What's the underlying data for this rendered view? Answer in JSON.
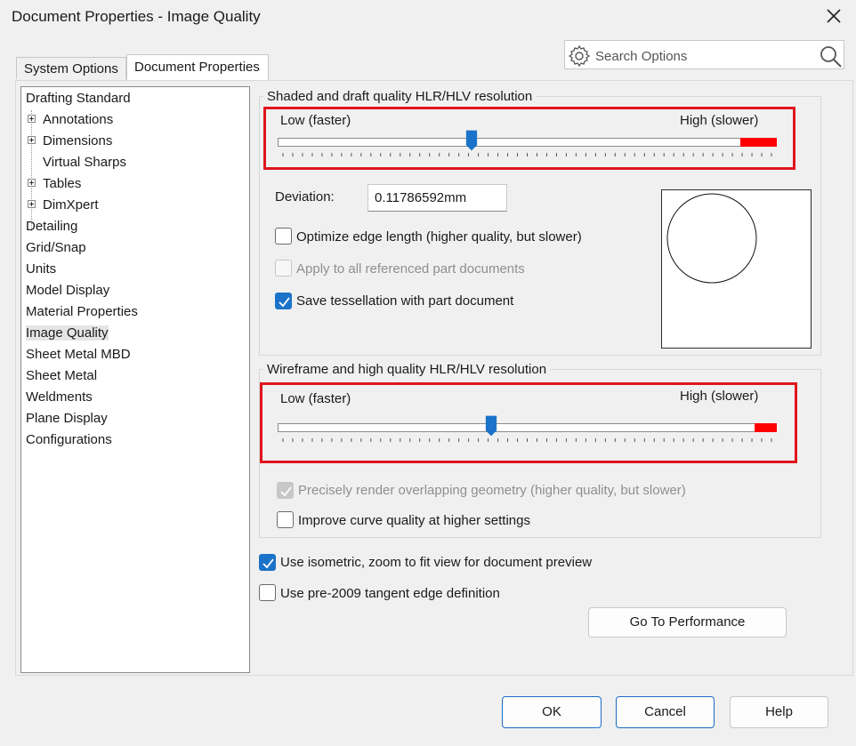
{
  "window": {
    "title": "Document Properties - Image Quality"
  },
  "search": {
    "placeholder": "Search Options"
  },
  "tabs": [
    {
      "label": "System Options",
      "selected": false
    },
    {
      "label": "Document Properties",
      "selected": true
    }
  ],
  "tree": [
    {
      "label": "Drafting Standard",
      "expandable": false,
      "indent": 0
    },
    {
      "label": "Annotations",
      "expandable": true,
      "indent": 1
    },
    {
      "label": "Dimensions",
      "expandable": true,
      "indent": 1
    },
    {
      "label": "Virtual Sharps",
      "expandable": false,
      "indent": 1
    },
    {
      "label": "Tables",
      "expandable": true,
      "indent": 1
    },
    {
      "label": "DimXpert",
      "expandable": true,
      "indent": 1
    },
    {
      "label": "Detailing",
      "expandable": false,
      "indent": 0
    },
    {
      "label": "Grid/Snap",
      "expandable": false,
      "indent": 0
    },
    {
      "label": "Units",
      "expandable": false,
      "indent": 0
    },
    {
      "label": "Model Display",
      "expandable": false,
      "indent": 0
    },
    {
      "label": "Material Properties",
      "expandable": false,
      "indent": 0
    },
    {
      "label": "Image Quality",
      "expandable": false,
      "indent": 0,
      "selected": true
    },
    {
      "label": "Sheet Metal MBD",
      "expandable": false,
      "indent": 0
    },
    {
      "label": "Sheet Metal",
      "expandable": false,
      "indent": 0
    },
    {
      "label": "Weldments",
      "expandable": false,
      "indent": 0
    },
    {
      "label": "Plane Display",
      "expandable": false,
      "indent": 0
    },
    {
      "label": "Configurations",
      "expandable": false,
      "indent": 0
    }
  ],
  "shaded": {
    "group_label": "Shaded and draft quality HLR/HLV resolution",
    "low_label": "Low (faster)",
    "high_label": "High (slower)",
    "slider_fraction": 0.39,
    "deviation_label": "Deviation:",
    "deviation_value": "0.11786592mm",
    "optimize_label": "Optimize edge length (higher quality, but slower)",
    "optimize_checked": false,
    "apply_label": "Apply to all referenced part documents",
    "apply_checked": false,
    "apply_enabled": false,
    "save_tess_label": "Save tessellation with part document",
    "save_tess_checked": true
  },
  "wireframe": {
    "group_label": "Wireframe and high quality HLR/HLV resolution",
    "low_label": "Low (faster)",
    "high_label": "High (slower)",
    "slider_fraction": 0.43,
    "precise_label": "Precisely render overlapping geometry (higher quality, but slower)",
    "precise_checked": true,
    "precise_enabled": false,
    "curve_label": "Improve curve quality at higher settings",
    "curve_checked": false
  },
  "options": {
    "isometric_label": "Use isometric, zoom to fit view for document preview",
    "isometric_checked": true,
    "pre2009_label": "Use pre-2009 tangent edge definition",
    "pre2009_checked": false
  },
  "buttons": {
    "performance": "Go To Performance",
    "ok": "OK",
    "cancel": "Cancel",
    "help": "Help"
  },
  "colors": {
    "accent": "#1a73c8",
    "highlight_box": "#e0141e",
    "slider_high_zone": "#ff0000"
  }
}
